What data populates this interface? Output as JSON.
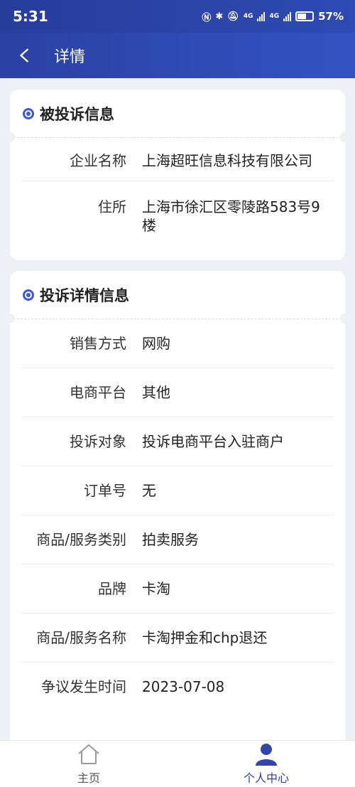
{
  "status_bar": {
    "time": "5:31",
    "network_1": "4G",
    "network_2": "4G",
    "battery": "57%"
  },
  "header": {
    "title": "详情"
  },
  "complained_info": {
    "title": "被投诉信息",
    "rows": [
      {
        "label": "企业名称",
        "value": "上海超旺信息科技有限公司"
      },
      {
        "label": "住所",
        "value": "上海市徐汇区零陵路583号9楼"
      }
    ]
  },
  "complaint_detail": {
    "title": "投诉详情信息",
    "rows": [
      {
        "label": "销售方式",
        "value": "网购"
      },
      {
        "label": "电商平台",
        "value": "其他"
      },
      {
        "label": "投诉对象",
        "value": "投诉电商平台入驻商户"
      },
      {
        "label": "订单号",
        "value": "无"
      },
      {
        "label": "商品/服务类别",
        "value": "拍卖服务"
      },
      {
        "label": "品牌",
        "value": "卡淘"
      },
      {
        "label": "商品/服务名称",
        "value": "卡淘押金和chp退还"
      },
      {
        "label": "争议发生时间",
        "value": "2023-07-08"
      }
    ]
  },
  "bottom_nav": {
    "home": "主页",
    "profile": "个人中心"
  },
  "colors": {
    "header": "#2e4ab3",
    "accent": "#3b5bd6",
    "nav_active": "#2d3f9e"
  }
}
